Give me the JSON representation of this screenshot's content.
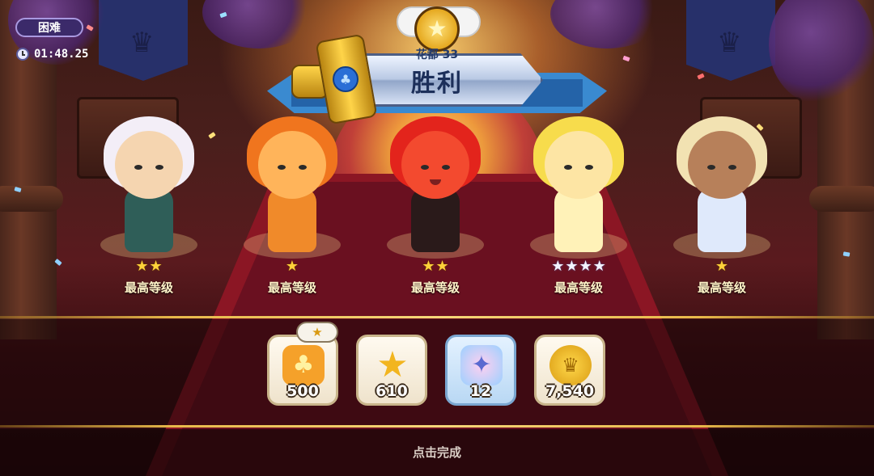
{
  "hud": {
    "difficulty": "困难",
    "timer": "01:48.25"
  },
  "result": {
    "stage": "花都 33",
    "title": "胜利"
  },
  "cookies": [
    {
      "stars": 2,
      "star_type": "gold",
      "level_label": "最高等级",
      "icon": "white-lily-cookie"
    },
    {
      "stars": 1,
      "star_type": "gold",
      "level_label": "最高等级",
      "icon": "fire-spirit-cookie"
    },
    {
      "stars": 2,
      "star_type": "gold",
      "level_label": "最高等级",
      "icon": "red-pepper-cookie"
    },
    {
      "stars": 4,
      "star_type": "silver",
      "level_label": "最高等级",
      "icon": "golden-flower-cookie"
    },
    {
      "stars": 1,
      "star_type": "gold",
      "level_label": "最高等级",
      "icon": "moonlight-cookie"
    }
  ],
  "rewards": [
    {
      "icon": "star-jelly-icon",
      "value": "500",
      "bonus": true
    },
    {
      "icon": "crown-star-icon",
      "value": "610",
      "bonus": false
    },
    {
      "icon": "jelly-bag-icon",
      "value": "12",
      "bonus": false
    },
    {
      "icon": "gold-coin-icon",
      "value": "7,540",
      "bonus": false
    }
  ],
  "footer": {
    "finish_label": "点击完成"
  },
  "colors": {
    "carpet": "#8b1624",
    "ribbon": "#3a8ad0",
    "gold_line": "#e8b94a",
    "difficulty_badge": "#3b2a6a"
  }
}
